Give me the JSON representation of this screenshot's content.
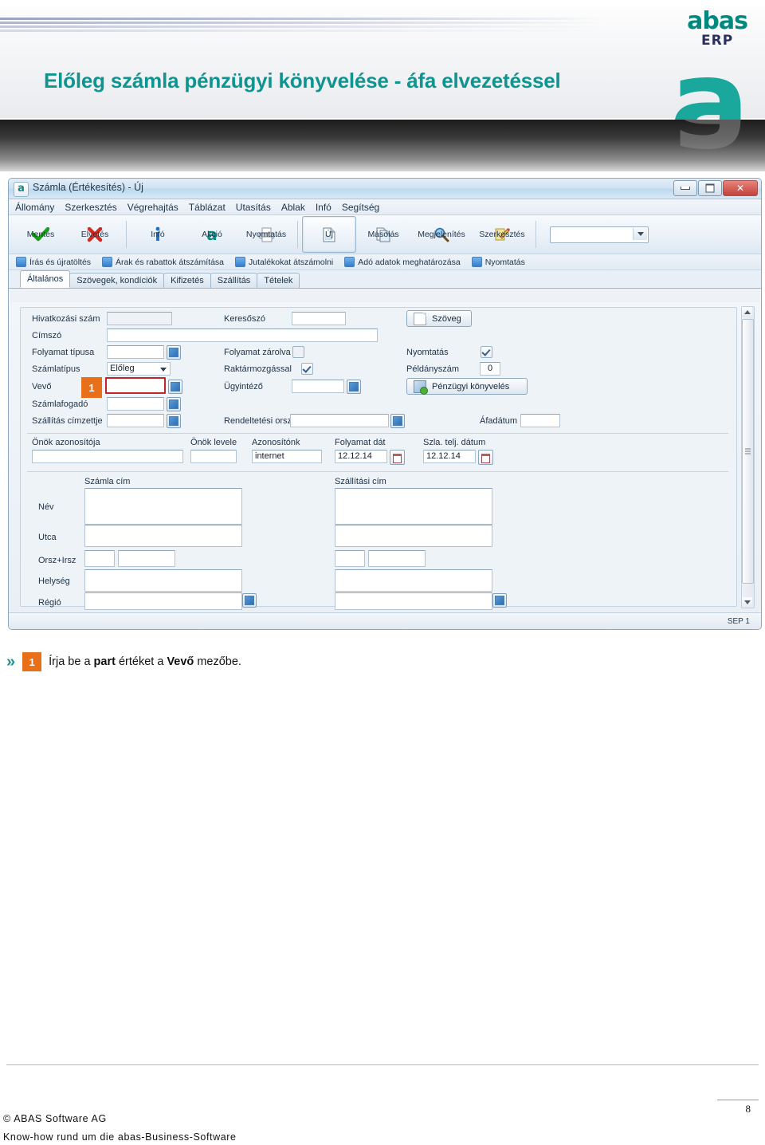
{
  "slide": {
    "title": "Előleg számla pénzügyi könyvelése - áfa elvezetéssel",
    "logo_main": "abas",
    "logo_sub": "ERP",
    "accent_teal": "#0f9591",
    "accent_orange": "#e8701a"
  },
  "window": {
    "title": "Számla (Értékesítés) - Új",
    "app_icon": "a",
    "controls": {
      "minimize": "minimize-icon",
      "maximize": "maximize-icon",
      "close": "close-icon"
    },
    "menus": [
      "Állomány",
      "Szerkesztés",
      "Végrehajtás",
      "Táblázat",
      "Utasítás",
      "Ablak",
      "Infó",
      "Segítség"
    ],
    "toolbar": [
      {
        "label": "Mentés",
        "icon": "check-icon",
        "selected": false
      },
      {
        "label": "Elvetés",
        "icon": "cross-icon",
        "selected": false
      },
      {
        "label": "Infó",
        "icon": "info-icon",
        "selected": false
      },
      {
        "label": "Akció",
        "icon": "abas-a-icon",
        "selected": false
      },
      {
        "label": "Nyomtatás",
        "icon": "printer-icon",
        "selected": false
      },
      {
        "label": "Új",
        "icon": "new-doc-icon",
        "selected": true
      },
      {
        "label": "Másolás",
        "icon": "copy-icon",
        "selected": false
      },
      {
        "label": "Megjelenítés",
        "icon": "magnifier-icon",
        "selected": false
      },
      {
        "label": "Szerkesztés",
        "icon": "pencil-icon",
        "selected": false
      }
    ],
    "toolbar_combo_value": "",
    "option_checks": [
      "Írás és újratöltés",
      "Árak és rabattok átszámítása",
      "Jutalékokat átszámolni",
      "Adó adatok meghatározása",
      "Nyomtatás"
    ],
    "tabs": [
      {
        "label": "Általános",
        "active": true
      },
      {
        "label": "Szövegek, kondíciók",
        "active": false
      },
      {
        "label": "Kifizetés",
        "active": false
      },
      {
        "label": "Szállítás",
        "active": false
      },
      {
        "label": "Tételek",
        "active": false
      }
    ],
    "status_right": "SEP 1"
  },
  "form": {
    "col1": [
      {
        "label": "Hivatkozási szám",
        "value": "",
        "type": "text-readonly"
      },
      {
        "label": "Címszó",
        "value": "",
        "type": "text-wide"
      },
      {
        "label": "Folyamat típusa",
        "value": "",
        "type": "text-picker"
      },
      {
        "label": "Számlatípus",
        "value": "Előleg",
        "type": "select"
      },
      {
        "label": "Vevő",
        "value": "",
        "type": "text-picker",
        "highlighted": true,
        "callout": "1"
      },
      {
        "label": "Számlafogadó",
        "value": "",
        "type": "text-picker"
      },
      {
        "label": "Szállítás címzettje",
        "value": "",
        "type": "text-picker"
      }
    ],
    "col2": [
      {
        "label": "Keresőszó",
        "value": "",
        "type": "text"
      },
      {
        "label": "Folyamat zárolva",
        "value": "",
        "type": "checkbox",
        "checked": false
      },
      {
        "label": "Raktármozgással",
        "value": "",
        "type": "checkbox",
        "checked": true
      },
      {
        "label": "Ügyintéző",
        "value": "",
        "type": "text-picker"
      },
      {
        "label": "Rendeltetési orsz",
        "value": "",
        "type": "text-picker"
      }
    ],
    "col3": [
      {
        "label": "Nyomtatás",
        "value": "",
        "type": "checkbox",
        "checked": true
      },
      {
        "label": "Példányszám",
        "value": "0",
        "type": "number"
      },
      {
        "label": "Áfadátum",
        "value": "",
        "type": "text"
      }
    ],
    "buttons": [
      {
        "label": "Szöveg",
        "icon": "document-icon"
      },
      {
        "label": "Pénzügyi könyvelés",
        "icon": "ledger-green-icon"
      }
    ],
    "idrow": [
      {
        "label": "Önök azonosítója",
        "value": ""
      },
      {
        "label": "Önök levele",
        "value": ""
      },
      {
        "label": "Azonosítónk",
        "value": "internet"
      },
      {
        "label": "Folyamat dát",
        "value": "12.12.14",
        "calendar": true
      },
      {
        "label": "Szla. telj. dátum",
        "value": "12.12.14",
        "calendar": true
      }
    ],
    "address": {
      "col_headers": [
        "Számla cím",
        "Szállítási cím"
      ],
      "row_labels": [
        "Név",
        "Utca",
        "Orsz+Irsz",
        "Helység",
        "Régió"
      ],
      "billing": {
        "nev": "",
        "utca": "",
        "orsz": "",
        "irsz": "",
        "helyseg": "",
        "regio": ""
      },
      "shipping": {
        "nev": "",
        "utca": "",
        "orsz": "",
        "irsz": "",
        "helyseg": "",
        "regio": ""
      }
    }
  },
  "caption": {
    "chevron": "double-chevron-icon",
    "number": "1",
    "text_before": "Írja be a ",
    "bold1": "part",
    "text_mid": " értéket a ",
    "bold2": "Vevő",
    "text_after": " mezőbe."
  },
  "footer": {
    "page_number": "8",
    "line1": "© ABAS Software AG",
    "line2": "Know-how rund um die abas-Business-Software"
  }
}
